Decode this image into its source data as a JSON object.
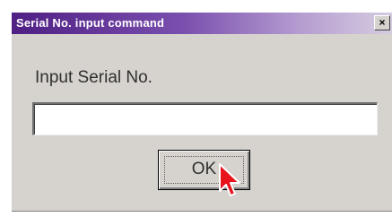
{
  "window": {
    "title": "Serial No. input command",
    "close_glyph": "×",
    "titlebar_color_start": "#4f1f84",
    "titlebar_color_end": "#d6cde0",
    "background": "#d6d3ce"
  },
  "form": {
    "prompt_label": "Input Serial No.",
    "serial_value": "",
    "ok_label": "OK"
  },
  "cursor": {
    "icon": "mouse-pointer-arrow-icon",
    "color": "#e8141c"
  }
}
